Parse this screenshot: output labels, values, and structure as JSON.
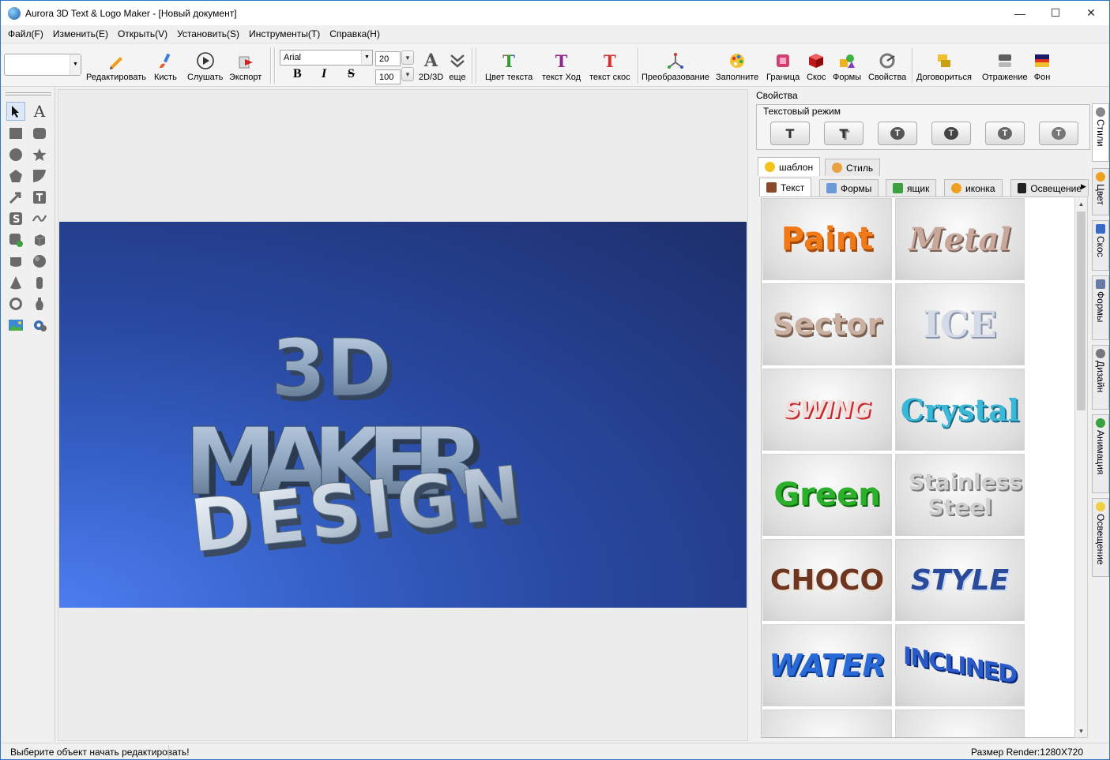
{
  "window": {
    "title": "Aurora 3D Text & Logo Maker - [Новый документ]",
    "controls": {
      "minimize": "—",
      "maximize": "☐",
      "close": "✕"
    }
  },
  "menu": [
    "Файл(F)",
    "Изменить(E)",
    "Открыть(V)",
    "Установить(S)",
    "Инструменты(T)",
    "Справка(H)"
  ],
  "toolbar": {
    "style_combo_value": "",
    "buttons": {
      "edit": "Редактировать",
      "brush": "Кисть",
      "listen": "Слушать",
      "export": "Экспорт",
      "mode2d3d": "2D/3D",
      "more": "еще",
      "text_color": "Цвет текста",
      "text_path": "текст Ход",
      "text_bevel": "текст скос",
      "transform": "Преобразование",
      "fill": "Заполните",
      "border": "Граница",
      "bevel": "Скос",
      "shapes": "Формы",
      "properties": "Свойства",
      "arrange": "Договориться",
      "reflection": "Отражение",
      "background": "Фон"
    },
    "font_name": "Arial",
    "font_size": "20",
    "font_scale": "100",
    "bold": "B",
    "italic": "I",
    "strike": "S"
  },
  "canvas": {
    "background_start": "#4d7df0",
    "background_end": "#1d2f6b",
    "text_line1": "3D",
    "text_line2": "MAKER",
    "text_line3": "DESIGN"
  },
  "properties": {
    "label": "Свойства",
    "text_mode_label": "Текстовый режим",
    "top_tabs": [
      "шаблон",
      "Стиль"
    ],
    "category_tabs": [
      "Текст",
      "Формы",
      "ящик",
      "иконка",
      "Освещение"
    ],
    "templates": [
      "Paint",
      "Metal",
      "Sector",
      "ICE",
      "SWING",
      "Crystal",
      "Green",
      "Stainless Steel",
      "CHOCO",
      "STYLE",
      "WATER",
      "INCLINED"
    ]
  },
  "side_tabs": [
    "Стили",
    "Цвет",
    "Скос",
    "Формы",
    "Дизайн",
    "Анимация",
    "Освещение"
  ],
  "status": {
    "left": "Выберите объект начать редактировать!",
    "right": "Размер Render:1280X720"
  }
}
